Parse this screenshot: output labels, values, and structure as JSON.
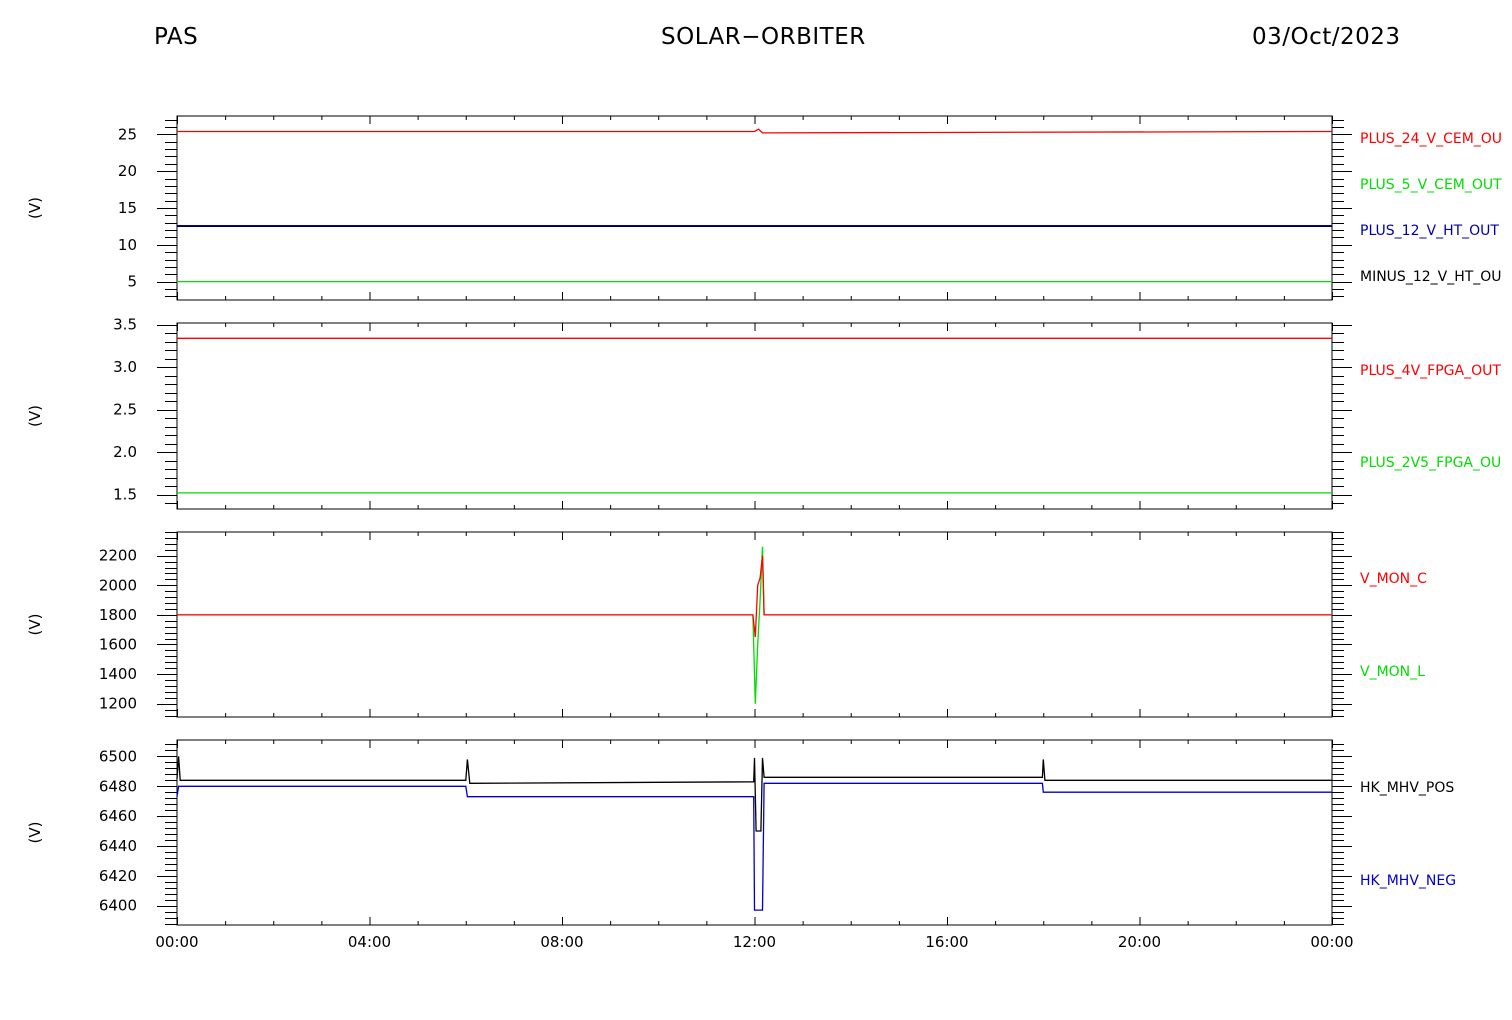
{
  "header": {
    "left": "PAS",
    "center": "SOLAR−ORBITER",
    "right": "03/Oct/2023"
  },
  "chart_data": [
    {
      "type": "line",
      "ylabel": "(V)",
      "ylim": [
        2.5,
        27.5
      ],
      "yticks": [
        5,
        10,
        15,
        20,
        25
      ],
      "ytick_labels": [
        "5",
        "10",
        "15",
        "20",
        "25"
      ],
      "x": [
        "00:00",
        "12:00",
        "12:05",
        "12:10",
        "24:00"
      ],
      "series": [
        {
          "name": "PLUS_24_V_CEM_OUT",
          "color": "#ff0000",
          "values": [
            25.4,
            25.4,
            25.7,
            25.2,
            25.4
          ]
        },
        {
          "name": "PLUS_5_V_CEM_OUT",
          "color": "#00dd00",
          "values": [
            5.0,
            5.0,
            5.0,
            5.0,
            5.0
          ]
        },
        {
          "name": "PLUS_12_V_HT_OUT",
          "color": "#0000aa",
          "values": [
            12.6,
            12.6,
            12.6,
            12.6,
            12.6
          ]
        },
        {
          "name": "MINUS_12_V_HT_OUT",
          "color": "#000000",
          "values": [
            12.5,
            12.5,
            12.5,
            12.5,
            12.5
          ]
        }
      ],
      "legend_labels": [
        "PLUS_24_V_CEM_OU",
        "PLUS_5_V_CEM_OUT",
        "PLUS_12_V_HT_OUT",
        "MINUS_12_V_HT_OU"
      ]
    },
    {
      "type": "line",
      "ylabel": "(V)",
      "ylim": [
        1.33,
        3.52
      ],
      "yticks": [
        1.5,
        2.0,
        2.5,
        3.0,
        3.5
      ],
      "ytick_labels": [
        "1.5",
        "2.0",
        "2.5",
        "3.0",
        "3.5"
      ],
      "x": [
        "00:00",
        "24:00"
      ],
      "series": [
        {
          "name": "PLUS_4V_FPGA_OUT",
          "color": "#ff0000",
          "values": [
            3.34,
            3.34
          ]
        },
        {
          "name": "PLUS_2V5_FPGA_OUT",
          "color": "#00dd00",
          "values": [
            1.52,
            1.52
          ]
        }
      ],
      "legend_labels": [
        "PLUS_4V_FPGA_OUT",
        "PLUS_2V5_FPGA_OU"
      ]
    },
    {
      "type": "line",
      "ylabel": "(V)",
      "ylim": [
        1110,
        2360
      ],
      "yticks": [
        1200,
        1400,
        1600,
        1800,
        2000,
        2200
      ],
      "ytick_labels": [
        "1200",
        "1400",
        "1600",
        "1800",
        "2000",
        "2200"
      ],
      "x": [
        "00:00",
        "11:58",
        "12:01",
        "12:04",
        "12:07",
        "12:10",
        "12:12",
        "24:00"
      ],
      "series": [
        {
          "name": "V_MON_C",
          "color": "#ff0000",
          "values": [
            1800,
            1800,
            1650,
            2000,
            2050,
            2200,
            1800,
            1800
          ]
        },
        {
          "name": "V_MON_L",
          "color": "#00dd00",
          "values": [
            1800,
            1800,
            1200,
            1600,
            1900,
            2260,
            1800,
            1800
          ]
        }
      ],
      "legend_labels": [
        "V_MON_C",
        "V_MON_L"
      ]
    },
    {
      "type": "line",
      "ylabel": "(V)",
      "ylim": [
        6387,
        6511
      ],
      "yticks": [
        6400,
        6420,
        6440,
        6460,
        6480,
        6500
      ],
      "ytick_labels": [
        "6400",
        "6420",
        "6440",
        "6460",
        "6480",
        "6500"
      ],
      "x": [
        "00:00",
        "00:02",
        "00:04",
        "06:00",
        "06:02",
        "06:05",
        "11:59",
        "12:00",
        "12:02",
        "12:08",
        "12:10",
        "12:12",
        "17:59",
        "18:00",
        "18:02",
        "24:00"
      ],
      "series": [
        {
          "name": "HK_MHV_POS",
          "color": "#000000",
          "values": [
            6485,
            6500,
            6484,
            6484,
            6498,
            6482,
            6483,
            6499,
            6450,
            6450,
            6499,
            6486,
            6486,
            6498,
            6484,
            6484
          ]
        },
        {
          "name": "HK_MHV_NEG",
          "color": "#0000cc",
          "values": [
            6473,
            6480,
            6480,
            6480,
            6473,
            6473,
            6473,
            6397,
            6397,
            6397,
            6397,
            6482,
            6482,
            6476,
            6476,
            6476
          ]
        }
      ],
      "legend_labels": [
        "HK_MHV_POS",
        "HK_MHV_NEG"
      ]
    }
  ],
  "xaxis": {
    "min_hours": 0,
    "max_hours": 24,
    "tick_labels": [
      "00:00",
      "04:00",
      "08:00",
      "12:00",
      "16:00",
      "20:00",
      "00:00"
    ]
  }
}
